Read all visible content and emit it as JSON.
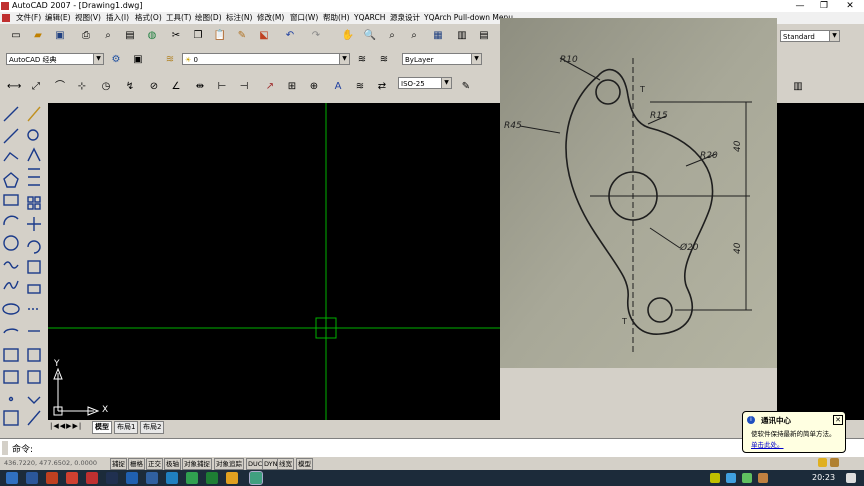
{
  "window": {
    "title": "AutoCAD 2007 - [Drawing1.dwg]",
    "min": "—",
    "max": "❐",
    "close": "✕"
  },
  "menu": [
    "文件(F)",
    "编辑(E)",
    "视图(V)",
    "插入(I)",
    "格式(O)",
    "工具(T)",
    "绘图(D)",
    "标注(N)",
    "修改(M)",
    "窗口(W)",
    "帮助(H)",
    "YQARCH",
    "源泉设计",
    "YQArch Pull-down Menu"
  ],
  "toolbar": {
    "style_combo": "Standard",
    "workspace_combo": "AutoCAD 经典",
    "layer_combo": "0",
    "color_combo": "ByLayer",
    "dim_combo": "ISO-25"
  },
  "layout_tabs": [
    "模型",
    "布局1",
    "布局2"
  ],
  "command": {
    "prompt": "命令:"
  },
  "status": {
    "coords": "436.7220, 477.6502, 0.0000",
    "buttons": [
      "捕捉",
      "栅格",
      "正交",
      "极轴",
      "对象捕捉",
      "对象追踪",
      "DUCS",
      "DYN",
      "线宽",
      "模型"
    ]
  },
  "ucs": {
    "x": "X",
    "y": "Y"
  },
  "drawing": {
    "labels": {
      "r10": "R10",
      "r45": "R45",
      "r15": "R15",
      "r20": "R20",
      "d20": "Ø20",
      "dim1": "40",
      "dim2": "40",
      "t1": "T",
      "t2": "T"
    }
  },
  "balloon": {
    "title": "通讯中心",
    "body": "使软件保持最新的简单方法。",
    "link": "单击此处。"
  },
  "taskbar": {
    "time": "20:23"
  }
}
